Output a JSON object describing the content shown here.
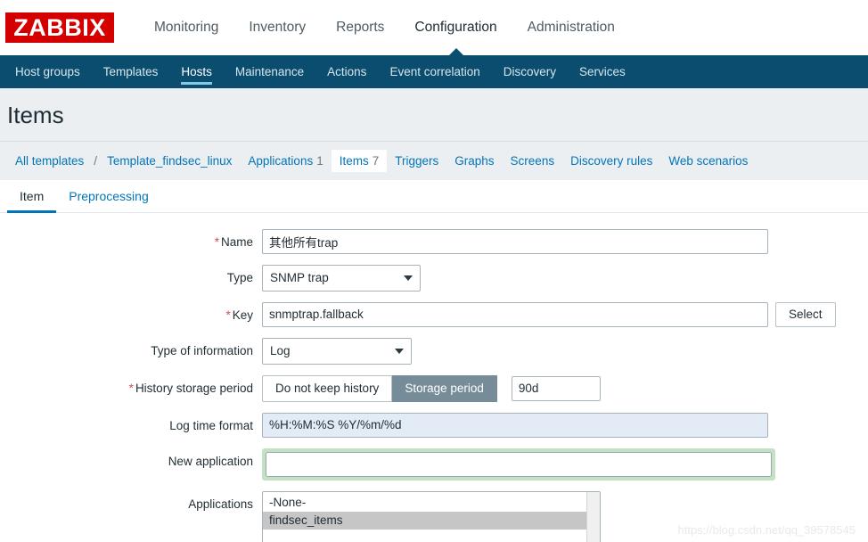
{
  "brand": {
    "logo_text": "ZABBIX",
    "logo_color": "#d40000"
  },
  "main_nav": {
    "items": [
      {
        "label": "Monitoring",
        "selected": false
      },
      {
        "label": "Inventory",
        "selected": false
      },
      {
        "label": "Reports",
        "selected": false
      },
      {
        "label": "Configuration",
        "selected": true
      },
      {
        "label": "Administration",
        "selected": false
      }
    ]
  },
  "sub_nav": {
    "background": "#0b4d6e",
    "accent": "#82c8e8",
    "items": [
      {
        "label": "Host groups",
        "selected": false
      },
      {
        "label": "Templates",
        "selected": false
      },
      {
        "label": "Hosts",
        "selected": true
      },
      {
        "label": "Maintenance",
        "selected": false
      },
      {
        "label": "Actions",
        "selected": false
      },
      {
        "label": "Event correlation",
        "selected": false
      },
      {
        "label": "Discovery",
        "selected": false
      },
      {
        "label": "Services",
        "selected": false
      }
    ]
  },
  "page": {
    "title": "Items"
  },
  "breadcrumb": {
    "all_templates": "All templates",
    "separator": "/",
    "template_name": "Template_findsec_linux",
    "tabs": [
      {
        "label": "Applications",
        "count": "1",
        "active": false
      },
      {
        "label": "Items",
        "count": "7",
        "active": true
      },
      {
        "label": "Triggers",
        "count": "",
        "active": false
      },
      {
        "label": "Graphs",
        "count": "",
        "active": false
      },
      {
        "label": "Screens",
        "count": "",
        "active": false
      },
      {
        "label": "Discovery rules",
        "count": "",
        "active": false
      },
      {
        "label": "Web scenarios",
        "count": "",
        "active": false
      }
    ]
  },
  "form_tabs": [
    {
      "label": "Item",
      "active": true
    },
    {
      "label": "Preprocessing",
      "active": false
    }
  ],
  "form": {
    "name": {
      "label": "Name",
      "required": true,
      "value": "其他所有trap"
    },
    "type": {
      "label": "Type",
      "required": false,
      "value": "SNMP trap"
    },
    "key": {
      "label": "Key",
      "required": true,
      "value": "snmptrap.fallback",
      "select_button": "Select"
    },
    "type_of_information": {
      "label": "Type of information",
      "required": false,
      "value": "Log"
    },
    "history_storage_period": {
      "label": "History storage period",
      "required": true,
      "option_off": "Do not keep history",
      "option_on": "Storage period",
      "selected": "Storage period",
      "period_value": "90d",
      "active_color": "#768d99"
    },
    "log_time_format": {
      "label": "Log time format",
      "required": false,
      "value": "%H:%M:%S %Y/%m/%d",
      "highlight_color": "#e3ebf7"
    },
    "new_application": {
      "label": "New application",
      "required": false,
      "value": "",
      "placeholder": "",
      "focus_ring_color": "#c3e2c3"
    },
    "applications": {
      "label": "Applications",
      "required": false,
      "options": [
        {
          "label": "-None-",
          "selected": false
        },
        {
          "label": "findsec_items",
          "selected": true
        }
      ]
    }
  },
  "watermark": {
    "text": "https://blog.csdn.net/qq_39578545"
  }
}
